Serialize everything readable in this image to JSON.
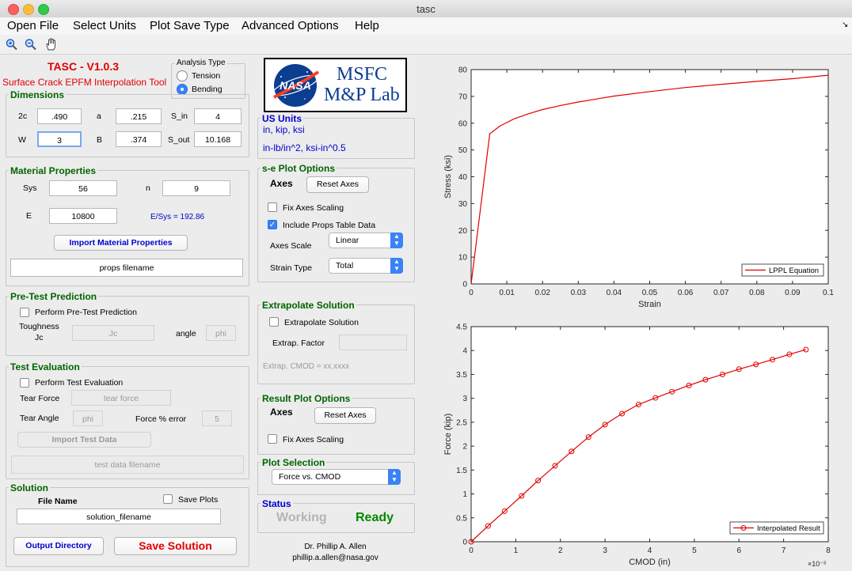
{
  "window": {
    "title": "tasc"
  },
  "menu": [
    "Open File",
    "Select Units",
    "Plot Save Type",
    "Advanced Options",
    "Help"
  ],
  "toolbar": {
    "icons": [
      "zoom-in-icon",
      "zoom-out-icon",
      "pan-hand-icon"
    ]
  },
  "header": {
    "title": "TASC - V1.0.3",
    "subtitle": "Surface Crack EPFM Interpolation Tool"
  },
  "analysis_type": {
    "title": "Analysis Type",
    "options": [
      "Tension",
      "Bending"
    ],
    "selected": "Bending"
  },
  "dimensions": {
    "title": "Dimensions",
    "labels": {
      "c2": "2c",
      "a": "a",
      "s_in": "S_in",
      "w": "W",
      "b": "B",
      "s_out": "S_out"
    },
    "values": {
      "c2": ".490",
      "a": ".215",
      "s_in": "4",
      "w": "3",
      "b": ".374",
      "s_out": "10.168"
    }
  },
  "material": {
    "title": "Material Properties",
    "labels": {
      "sys": "Sys",
      "n": "n",
      "e": "E"
    },
    "values": {
      "sys": "56",
      "n": "9",
      "e": "10800"
    },
    "ratio": "E/Sys = 192.86",
    "import_button": "Import Material Properties",
    "filename": "props filename"
  },
  "pretest": {
    "title": "Pre-Test Prediction",
    "checkbox": "Perform Pre-Test Prediction",
    "toughness_label": "Toughness",
    "jc_label": "Jc",
    "jc_placeholder": "Jc",
    "angle_label": "angle",
    "phi_placeholder": "phi"
  },
  "test_eval": {
    "title": "Test Evaluation",
    "checkbox": "Perform Test Evaluation",
    "tear_force_label": "Tear Force",
    "tear_force_placeholder": "tear force",
    "tear_angle_label": "Tear Angle",
    "tear_angle_placeholder": "phi",
    "force_error_label": "Force % error",
    "force_error_value": "5",
    "import_button": "Import Test Data",
    "filename": "test data filename"
  },
  "solution": {
    "title": "Solution",
    "file_name_label": "File Name",
    "save_plots_label": "Save Plots",
    "filename": "solution_filename",
    "output_button": "Output Directory",
    "save_button": "Save Solution"
  },
  "logo": {
    "nasa": "NASA",
    "line1": "MSFC",
    "line2": "M&P Lab"
  },
  "units": {
    "title": "US Units",
    "line1": "in, kip, ksi",
    "line2": "in-lb/in^2, ksi-in^0.5"
  },
  "se_plot": {
    "title": "s-e Plot Options",
    "axes_label": "Axes",
    "reset_button": "Reset Axes",
    "fix_scaling": "Fix Axes Scaling",
    "include_props": "Include Props Table Data",
    "axes_scale_label": "Axes Scale",
    "axes_scale_value": "Linear",
    "strain_type_label": "Strain Type",
    "strain_type_value": "Total"
  },
  "extrapolate": {
    "title": "Extrapolate Solution",
    "checkbox": "Extrapolate Solution",
    "factor_label": "Extrap. Factor",
    "cmod_text": "Extrap. CMOD = xx.xxxx"
  },
  "result_plot": {
    "title": "Result Plot Options",
    "axes_label": "Axes",
    "reset_button": "Reset Axes",
    "fix_scaling": "Fix Axes Scaling"
  },
  "plot_selection": {
    "title": "Plot Selection",
    "value": "Force vs. CMOD"
  },
  "status": {
    "title": "Status",
    "working": "Working",
    "ready": "Ready"
  },
  "credit": {
    "name": "Dr. Phillip A. Allen",
    "email": "phillip.a.allen@nasa.gov"
  },
  "colors": {
    "green": "#006400",
    "red": "#e00000",
    "blue": "#0000cc",
    "accent": "#3a82f7"
  },
  "chart_data": [
    {
      "type": "line",
      "xlabel": "Strain",
      "ylabel": "Stress (ksi)",
      "xlim": [
        0,
        0.1
      ],
      "ylim": [
        0,
        80
      ],
      "xticks": [
        "0",
        "0.01",
        "0.02",
        "0.03",
        "0.04",
        "0.05",
        "0.06",
        "0.07",
        "0.08",
        "0.09",
        "0.1"
      ],
      "yticks": [
        "0",
        "10",
        "20",
        "30",
        "40",
        "50",
        "60",
        "70",
        "80"
      ],
      "legend": "bottom-right",
      "series": [
        {
          "name": "LPPL Equation",
          "color": "#e00000",
          "marker": "none",
          "x": [
            0,
            0.0052,
            0.008,
            0.012,
            0.016,
            0.02,
            0.025,
            0.03,
            0.04,
            0.05,
            0.06,
            0.07,
            0.08,
            0.09,
            0.1
          ],
          "y": [
            0,
            56,
            58.9,
            61.6,
            63.5,
            65.1,
            66.6,
            67.9,
            70.1,
            71.8,
            73.3,
            74.5,
            75.6,
            76.6,
            77.9
          ]
        }
      ]
    },
    {
      "type": "line",
      "xlabel": "CMOD (in)",
      "ylabel": "Force (kip)",
      "x_multiplier": "×10⁻³",
      "xlim": [
        0,
        8
      ],
      "ylim": [
        0,
        4.5
      ],
      "xticks": [
        "0",
        "1",
        "2",
        "3",
        "4",
        "5",
        "6",
        "7",
        "8"
      ],
      "yticks": [
        "0",
        "0.5",
        "1",
        "1.5",
        "2",
        "2.5",
        "3",
        "3.5",
        "4",
        "4.5"
      ],
      "legend": "bottom-right",
      "series": [
        {
          "name": "Interpolated Result",
          "color": "#e00000",
          "marker": "circle",
          "x": [
            0,
            0.38,
            0.75,
            1.13,
            1.5,
            1.88,
            2.25,
            2.63,
            3.0,
            3.38,
            3.75,
            4.13,
            4.5,
            4.88,
            5.25,
            5.63,
            6.0,
            6.38,
            6.75,
            7.13,
            7.5
          ],
          "y": [
            0,
            0.33,
            0.64,
            0.96,
            1.28,
            1.59,
            1.89,
            2.19,
            2.45,
            2.68,
            2.87,
            3.01,
            3.14,
            3.27,
            3.39,
            3.5,
            3.61,
            3.71,
            3.81,
            3.92,
            4.02
          ]
        }
      ]
    }
  ]
}
